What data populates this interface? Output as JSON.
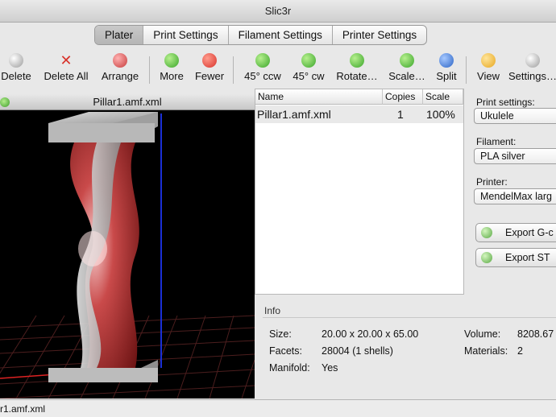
{
  "window": {
    "title": "Slic3r"
  },
  "tabs": [
    "Plater",
    "Print Settings",
    "Filament Settings",
    "Printer Settings"
  ],
  "toolbar": {
    "delete": "Delete",
    "delete_all": "Delete All",
    "arrange": "Arrange",
    "more": "More",
    "fewer": "Fewer",
    "rotate_ccw": "45° ccw",
    "rotate_cw": "45° cw",
    "rotate": "Rotate…",
    "scale": "Scale…",
    "split": "Split",
    "view": "View",
    "settings": "Settings…"
  },
  "viewport": {
    "title": "Pillar1.amf.xml"
  },
  "object_list": {
    "headers": {
      "name": "Name",
      "copies": "Copies",
      "scale": "Scale"
    },
    "rows": [
      {
        "name": "Pillar1.amf.xml",
        "copies": "1",
        "scale": "100%"
      }
    ]
  },
  "settings": {
    "print_label": "Print settings:",
    "print_value": "Ukulele",
    "filament_label": "Filament:",
    "filament_value": "PLA silver",
    "printer_label": "Printer:",
    "printer_value": "MendelMax larg",
    "export_gcode": "Export G-c",
    "export_stl": "Export ST"
  },
  "info": {
    "title": "Info",
    "size_label": "Size:",
    "size_value": "20.00 x 20.00 x 65.00",
    "facets_label": "Facets:",
    "facets_value": "28004 (1 shells)",
    "manifold_label": "Manifold:",
    "manifold_value": "Yes",
    "volume_label": "Volume:",
    "volume_value": "8208.67",
    "materials_label": "Materials:",
    "materials_value": "2"
  },
  "status": {
    "text": "r1.amf.xml"
  }
}
